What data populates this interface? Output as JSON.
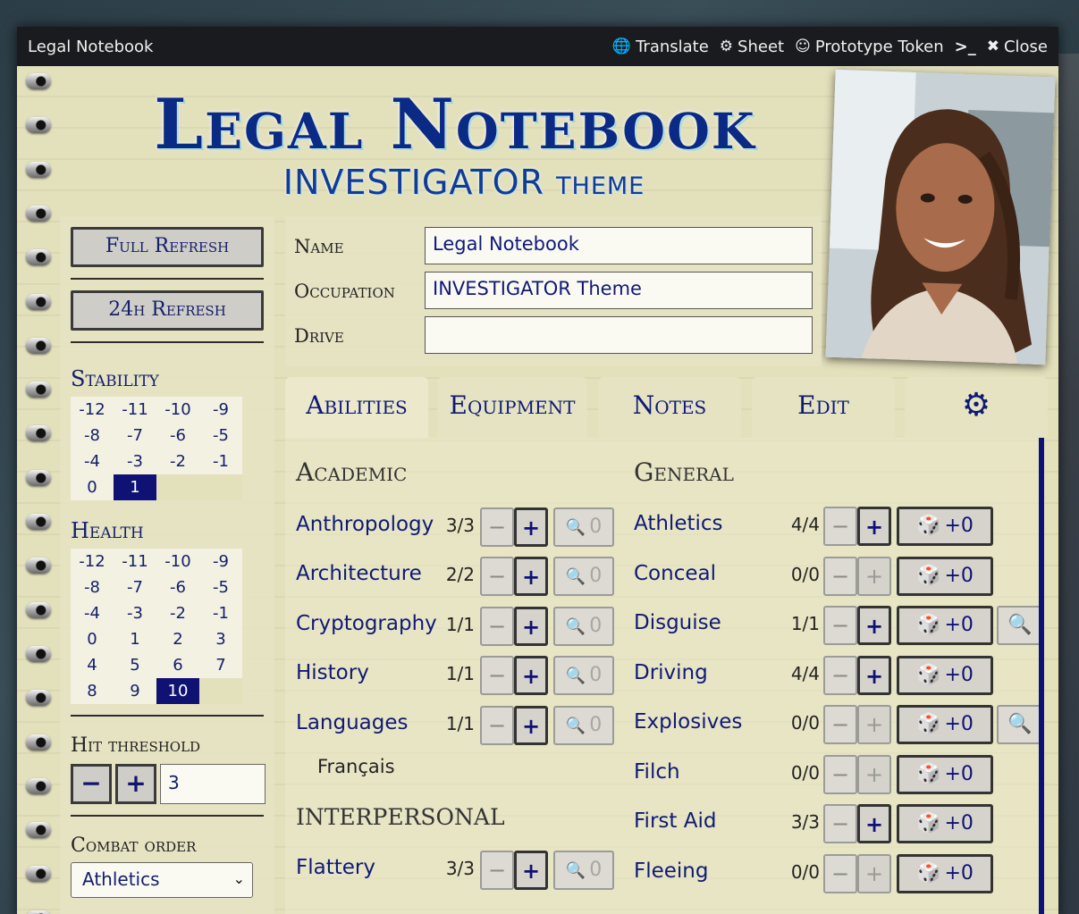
{
  "window": {
    "title": "Legal Notebook",
    "buttons": {
      "translate": "Translate",
      "sheet": "Sheet",
      "prototype_token": "Prototype Token",
      "console": ">_",
      "close": "Close"
    }
  },
  "header": {
    "title": "Legal Notebook",
    "subtitle": "INVESTIGATOR theme"
  },
  "sidebar": {
    "full_refresh": "Full Refresh",
    "refresh_24h": "24h Refresh",
    "stability_title": "Stability",
    "stability_values": [
      "-12",
      "-11",
      "-10",
      "-9",
      "-8",
      "-7",
      "-6",
      "-5",
      "-4",
      "-3",
      "-2",
      "-1",
      "0",
      "1"
    ],
    "stability_selected": "1",
    "health_title": "Health",
    "health_values": [
      "-12",
      "-11",
      "-10",
      "-9",
      "-8",
      "-7",
      "-6",
      "-5",
      "-4",
      "-3",
      "-2",
      "-1",
      "0",
      "1",
      "2",
      "3",
      "4",
      "5",
      "6",
      "7",
      "8",
      "9",
      "10"
    ],
    "health_selected": "10",
    "hit_threshold_title": "Hit threshold",
    "hit_threshold_value": "3",
    "minus_label": "−",
    "plus_label": "+",
    "combat_order_title": "Combat order",
    "combat_order_value": "Athletics"
  },
  "fields": {
    "name_label": "Name",
    "name_value": "Legal Notebook",
    "occupation_label": "Occupation",
    "occupation_value": "INVESTIGATOR Theme",
    "drive_label": "Drive",
    "drive_value": ""
  },
  "tabs": {
    "abilities": "Abilities",
    "equipment": "Equipment",
    "notes": "Notes",
    "edit": "Edit"
  },
  "academic": {
    "title": "Academic",
    "items": [
      {
        "name": "Anthropology",
        "value": "3/3",
        "spend": "0"
      },
      {
        "name": "Architecture",
        "value": "2/2",
        "spend": "0"
      },
      {
        "name": "Cryptography",
        "value": "1/1",
        "spend": "0"
      },
      {
        "name": "History",
        "value": "1/1",
        "spend": "0"
      },
      {
        "name": "Languages",
        "value": "1/1",
        "spend": "0"
      }
    ],
    "language_sub": "Français"
  },
  "interpersonal": {
    "title": "INTERPERSONAL",
    "items": [
      {
        "name": "Flattery",
        "value": "3/3",
        "spend": "0"
      }
    ]
  },
  "general": {
    "title": "General",
    "items": [
      {
        "name": "Athletics",
        "value": "4/4",
        "dice": "+0"
      },
      {
        "name": "Conceal",
        "value": "0/0",
        "dice": "+0"
      },
      {
        "name": "Disguise",
        "value": "1/1",
        "dice": "+0"
      },
      {
        "name": "Driving",
        "value": "4/4",
        "dice": "+0"
      },
      {
        "name": "Explosives",
        "value": "0/0",
        "dice": "+0"
      },
      {
        "name": "Filch",
        "value": "0/0",
        "dice": "+0"
      },
      {
        "name": "First Aid",
        "value": "3/3",
        "dice": "+0"
      },
      {
        "name": "Fleeing",
        "value": "0/0",
        "dice": "+0"
      }
    ]
  },
  "colors": {
    "accent_blue": "#0f1273",
    "title_bar": "#191b1e",
    "paper": "#e3e0bc"
  }
}
